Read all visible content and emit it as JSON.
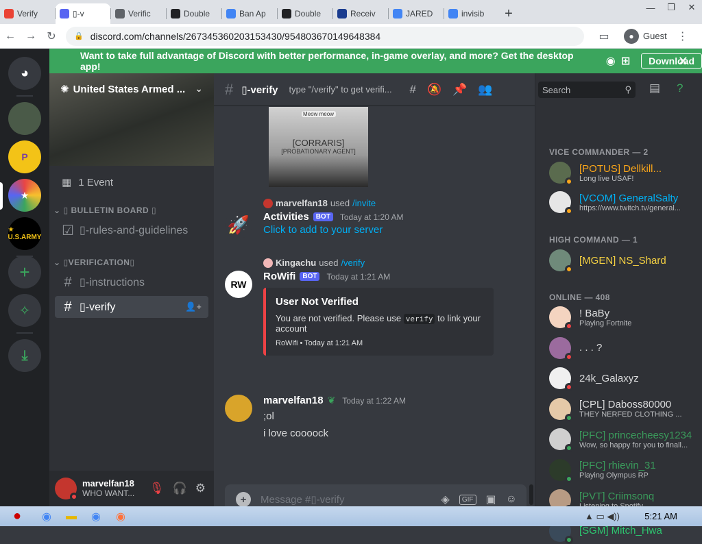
{
  "browser": {
    "tabs": [
      {
        "label": "Verify",
        "color": "#ea4335"
      },
      {
        "label": "▯-v",
        "color": "#5865f2",
        "active": true
      },
      {
        "label": "Verific",
        "color": "#5f6368"
      },
      {
        "label": "Double",
        "color": "#202124"
      },
      {
        "label": "Ban Ap",
        "color": "#4285f4"
      },
      {
        "label": "Double",
        "color": "#202124"
      },
      {
        "label": "Receiv",
        "color": "#1a3c8f"
      },
      {
        "label": "JARED",
        "color": "#4285f4"
      },
      {
        "label": "invisib",
        "color": "#4285f4"
      }
    ],
    "new_tab": "+",
    "url": "discord.com/channels/267345360203153430/954803670149648384",
    "profile_label": "Guest"
  },
  "banner": {
    "message": "Want to take full advantage of Discord with better performance, in-game overlay, and more? Get the desktop app!",
    "download_label": "Download",
    "close": "✕"
  },
  "server": {
    "name": "United States Armed ...",
    "event_label": "1 Event",
    "categories": [
      {
        "name": "▯ BULLETIN BOARD ▯"
      },
      {
        "name": "▯VERIFICATION▯"
      }
    ],
    "channels": {
      "rules": "▯-rules-and-guidelines",
      "instructions": "▯-instructions",
      "verify": "▯-verify"
    }
  },
  "user": {
    "name": "marvelfan18",
    "status": "WHO WANT..."
  },
  "channel_header": {
    "name": "▯-verify",
    "topic": "type \"/verify\" to get verifi..."
  },
  "messages": {
    "image_text_1": "[CORRARIS]",
    "image_text_2": "[PROBATIONARY AGENT]",
    "image_badge": "Meow meow",
    "m1": {
      "reply_user": "marvelfan18",
      "reply_used": "used",
      "reply_cmd": "/invite",
      "author": "Activities",
      "bot": "BOT",
      "time": "Today at 1:20 AM",
      "link": "Click to add to your server"
    },
    "m2": {
      "reply_user": "Kingachu",
      "reply_used": "used",
      "reply_cmd": "/verify",
      "author": "RoWifi",
      "bot": "BOT",
      "time": "Today at 1:21 AM",
      "embed_title": "User Not Verified",
      "embed_text_1": "You are not verified. Please use",
      "embed_code": "verify",
      "embed_text_2": "to link your account",
      "embed_footer": "RoWifi • Today at 1:21 AM"
    },
    "m3": {
      "author": "marvelfan18",
      "time": "Today at 1:22 AM",
      "line1": ";ol",
      "line2": "i love coooock"
    }
  },
  "input": {
    "placeholder": "Message #▯-verify",
    "gif": "GIF"
  },
  "members": {
    "search_placeholder": "Search",
    "groups": {
      "vice": "VICE COMMANDER — 2",
      "high": "HIGH COMMAND — 1",
      "online": "ONLINE — 408"
    },
    "vice": [
      {
        "name": "[POTUS] Dellkill...",
        "status": "Long live USAF!",
        "color": "#faa61a"
      },
      {
        "name": "[VCOM] GeneralSalty",
        "status": "https://www.twitch.tv/general...",
        "color": "#00b0f4"
      }
    ],
    "high": [
      {
        "name": "[MGEN] NS_Shard",
        "status": "",
        "color": "#f5d142"
      }
    ],
    "online": [
      {
        "name": "! BaBy",
        "status": "Playing Fortnite",
        "color": "#dcddde",
        "st": "#ed4245"
      },
      {
        "name": ". . . ?",
        "status": "",
        "color": "#dcddde",
        "st": "#ed4245"
      },
      {
        "name": "24k_Galaxyz",
        "status": "",
        "color": "#dcddde",
        "st": "#ed4245"
      },
      {
        "name": "[CPL] Daboss80000",
        "status": "THEY NERFED CLOTHING ...",
        "color": "#dcddde",
        "st": "#3ba55d"
      },
      {
        "name": "[PFC] princecheesy1234",
        "status": "Wow, so happy for you to finall...",
        "color": "#3a9a5b",
        "st": "#3ba55d"
      },
      {
        "name": "[PFC] rhievin_31",
        "status": "Playing Olympus RP",
        "color": "#3a9a5b",
        "st": "#3ba55d"
      },
      {
        "name": "[PVT] Criimsonq",
        "status": "Listening to Spotify",
        "color": "#3a9a5b",
        "st": "#ed4245"
      },
      {
        "name": "[SGM] Mitch_Hwa",
        "status": "",
        "color": "#2dc770",
        "st": "#3ba55d"
      }
    ]
  },
  "taskbar": {
    "clock": "5:21 AM"
  }
}
